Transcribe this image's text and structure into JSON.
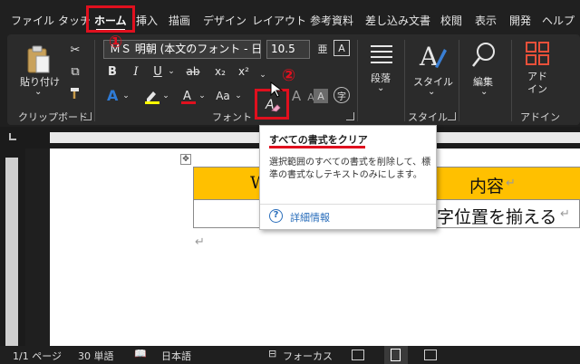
{
  "tabs": [
    {
      "label": "ファイル"
    },
    {
      "label": "タッチ"
    },
    {
      "label": "ホーム"
    },
    {
      "label": "挿入"
    },
    {
      "label": "描画"
    },
    {
      "label": "デザイン"
    },
    {
      "label": "レイアウト"
    },
    {
      "label": "参考資料"
    },
    {
      "label": "差し込み文書"
    },
    {
      "label": "校閲"
    },
    {
      "label": "表示"
    },
    {
      "label": "開発"
    },
    {
      "label": "ヘルプ"
    }
  ],
  "annotations": {
    "marker1": "①",
    "marker2": "②",
    "color": "#e0101e"
  },
  "ribbon": {
    "clipboard": {
      "paste_label": "貼り付け",
      "group_label": "クリップボード"
    },
    "font": {
      "font_name": "ＭＳ 明朝 (本文のフォント - 日:",
      "font_size": "10.5",
      "group_label": "フォント",
      "bold": "B",
      "italic": "I",
      "underline": "U",
      "strike": "ab",
      "sub": "x₂",
      "sup": "x²",
      "font_color": "#e0101e",
      "highlight_color": "#ffff00"
    },
    "paragraph": {
      "label": "段落"
    },
    "styles": {
      "label": "スタイル",
      "group_label": "スタイル"
    },
    "editing": {
      "label": "編集"
    },
    "addins": {
      "label": "アド\nイン",
      "group_label": "アドイン"
    }
  },
  "document": {
    "header_cell_1": "W",
    "header_cell_2": "内容",
    "body_cell_2": "字位置を揃える",
    "para_mark": "↵",
    "header_color": "#ffc000"
  },
  "tooltip": {
    "title": "すべての書式をクリア",
    "description": "選択範囲のすべての書式を削除して、標準の書式なしテキストのみにします。",
    "help_label": "詳細情報",
    "help_icon": "?"
  },
  "status": {
    "page": "1/1 ページ",
    "words": "30 単語",
    "language": "日本語",
    "focus": "フォーカス"
  }
}
